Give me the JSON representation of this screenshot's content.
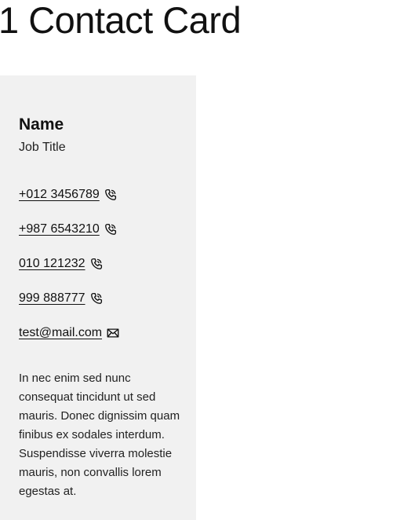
{
  "page": {
    "title": "1 Contact Card"
  },
  "card": {
    "name": "Name",
    "job_title": "Job Title",
    "contacts": [
      {
        "label": "+012 3456789",
        "type": "phone",
        "icon": "phone-icon"
      },
      {
        "label": "+987 6543210",
        "type": "phone",
        "icon": "phone-icon"
      },
      {
        "label": "010 121232",
        "type": "phone",
        "icon": "phone-icon"
      },
      {
        "label": "999 888777",
        "type": "phone",
        "icon": "phone-icon"
      },
      {
        "label": "test@mail.com",
        "type": "email",
        "icon": "mail-icon"
      }
    ],
    "bio": "In nec enim sed nunc consequat tincidunt ut sed mauris. Donec dignissim quam finibus ex sodales interdum. Suspendisse viverra molestie mauris, non convallis lorem egestas at."
  },
  "colors": {
    "card_background": "#f1f1f1",
    "text": "#111111"
  }
}
